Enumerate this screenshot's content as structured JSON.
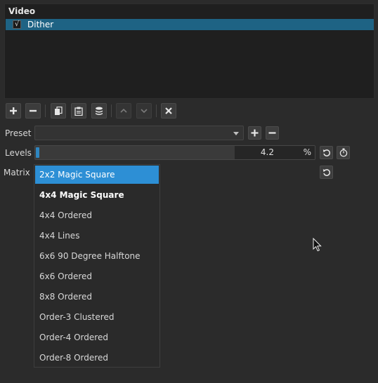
{
  "filters_panel": {
    "header": "Video",
    "items": [
      {
        "label": "Dither",
        "checked": true,
        "check_glyph": "√"
      }
    ]
  },
  "toolbar": {
    "buttons": [
      {
        "icon": "plus-icon",
        "enabled": true
      },
      {
        "icon": "minus-icon",
        "enabled": true
      },
      {
        "icon": "copy-icon",
        "enabled": true
      },
      {
        "icon": "paste-icon",
        "enabled": true
      },
      {
        "icon": "stack-icon",
        "enabled": true
      },
      {
        "icon": "chevron-up-icon",
        "enabled": false
      },
      {
        "icon": "chevron-down-icon",
        "enabled": false
      },
      {
        "icon": "close-icon",
        "enabled": true
      }
    ]
  },
  "preset": {
    "label": "Preset",
    "value": ""
  },
  "levels": {
    "label": "Levels",
    "value": "4.2",
    "unit": "%",
    "fraction": 0.042
  },
  "matrix": {
    "label": "Matrix",
    "options": [
      "2x2 Magic Square",
      "4x4 Magic Square",
      "4x4 Ordered",
      "4x4 Lines",
      "6x6 90 Degree Halftone",
      "6x6 Ordered",
      "8x8 Ordered",
      "Order-3 Clustered",
      "Order-4 Ordered",
      "Order-8 Ordered"
    ],
    "highlighted_index": 0,
    "current_index": 1
  },
  "colors": {
    "accent": "#2d8fd5",
    "selection_row": "#1e6384",
    "background": "#2b2b2b"
  }
}
